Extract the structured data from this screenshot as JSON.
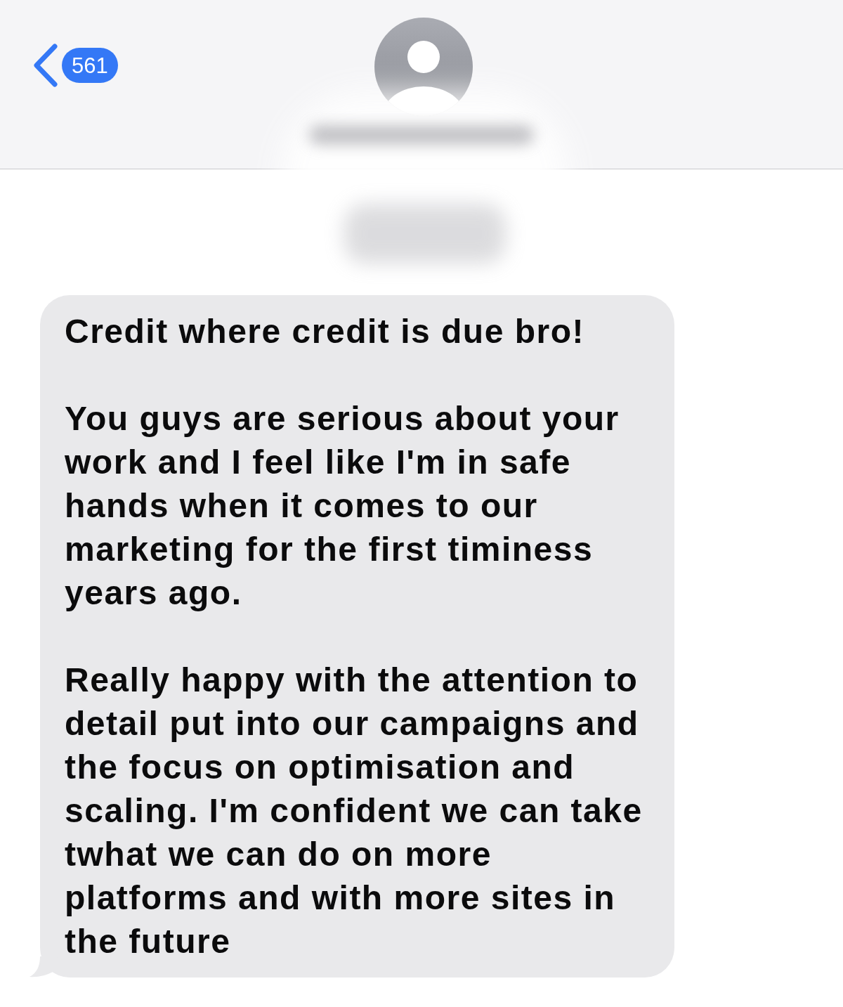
{
  "header": {
    "back_button": {
      "unread_count": "561"
    }
  },
  "messages": [
    {
      "paragraphs": [
        "Credit where credit is due bro!",
        "You guys are serious about your work and I feel like I'm in safe hands when it comes to our marketing for the first timiness years ago.",
        "Really happy with the attention to detail put into our campaigns and the focus on optimisation and scaling. I'm confident we can take twhat we can do on more platforms and with more sites in the future"
      ]
    }
  ]
}
